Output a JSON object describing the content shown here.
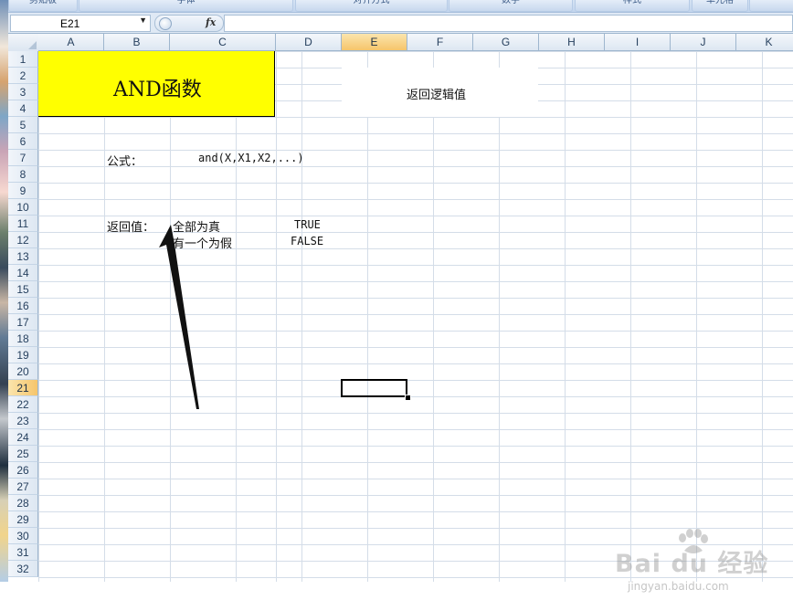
{
  "ribbon": {
    "groups": [
      "剪贴板",
      "字体",
      "对齐方式",
      "数字",
      "样式",
      "单元格",
      ""
    ]
  },
  "formula_bar": {
    "name_box": "E21",
    "fx_label": "fx",
    "formula": ""
  },
  "sheet": {
    "columns": [
      "A",
      "B",
      "C",
      "D",
      "E",
      "F",
      "G",
      "H",
      "I",
      "J",
      "K"
    ],
    "active_column": "E",
    "rows": [
      "1",
      "2",
      "3",
      "4",
      "5",
      "6",
      "7",
      "8",
      "9",
      "10",
      "11",
      "12",
      "13",
      "14",
      "15",
      "16",
      "17",
      "18",
      "19",
      "20",
      "21",
      "22",
      "23",
      "24",
      "25",
      "26",
      "27",
      "28",
      "29",
      "30",
      "31",
      "32"
    ],
    "active_row": "21",
    "active_cell": "E21"
  },
  "content": {
    "title": "AND函数",
    "note": "返回逻辑值",
    "formula_label": "公式：",
    "formula_text": "and(X,X1,X2,...)",
    "return_label": "返回值：",
    "case_all_true": "全部为真",
    "case_all_true_value": "TRUE",
    "case_one_false": "有一个为假",
    "case_one_false_value": "FALSE"
  },
  "watermark": {
    "brand": "Bai du 经验",
    "url": "jingyan.baidu.com"
  },
  "colors": {
    "title_fill": "#ffff00",
    "header_active": "#f6c56b",
    "gridline": "#d4dde8"
  }
}
